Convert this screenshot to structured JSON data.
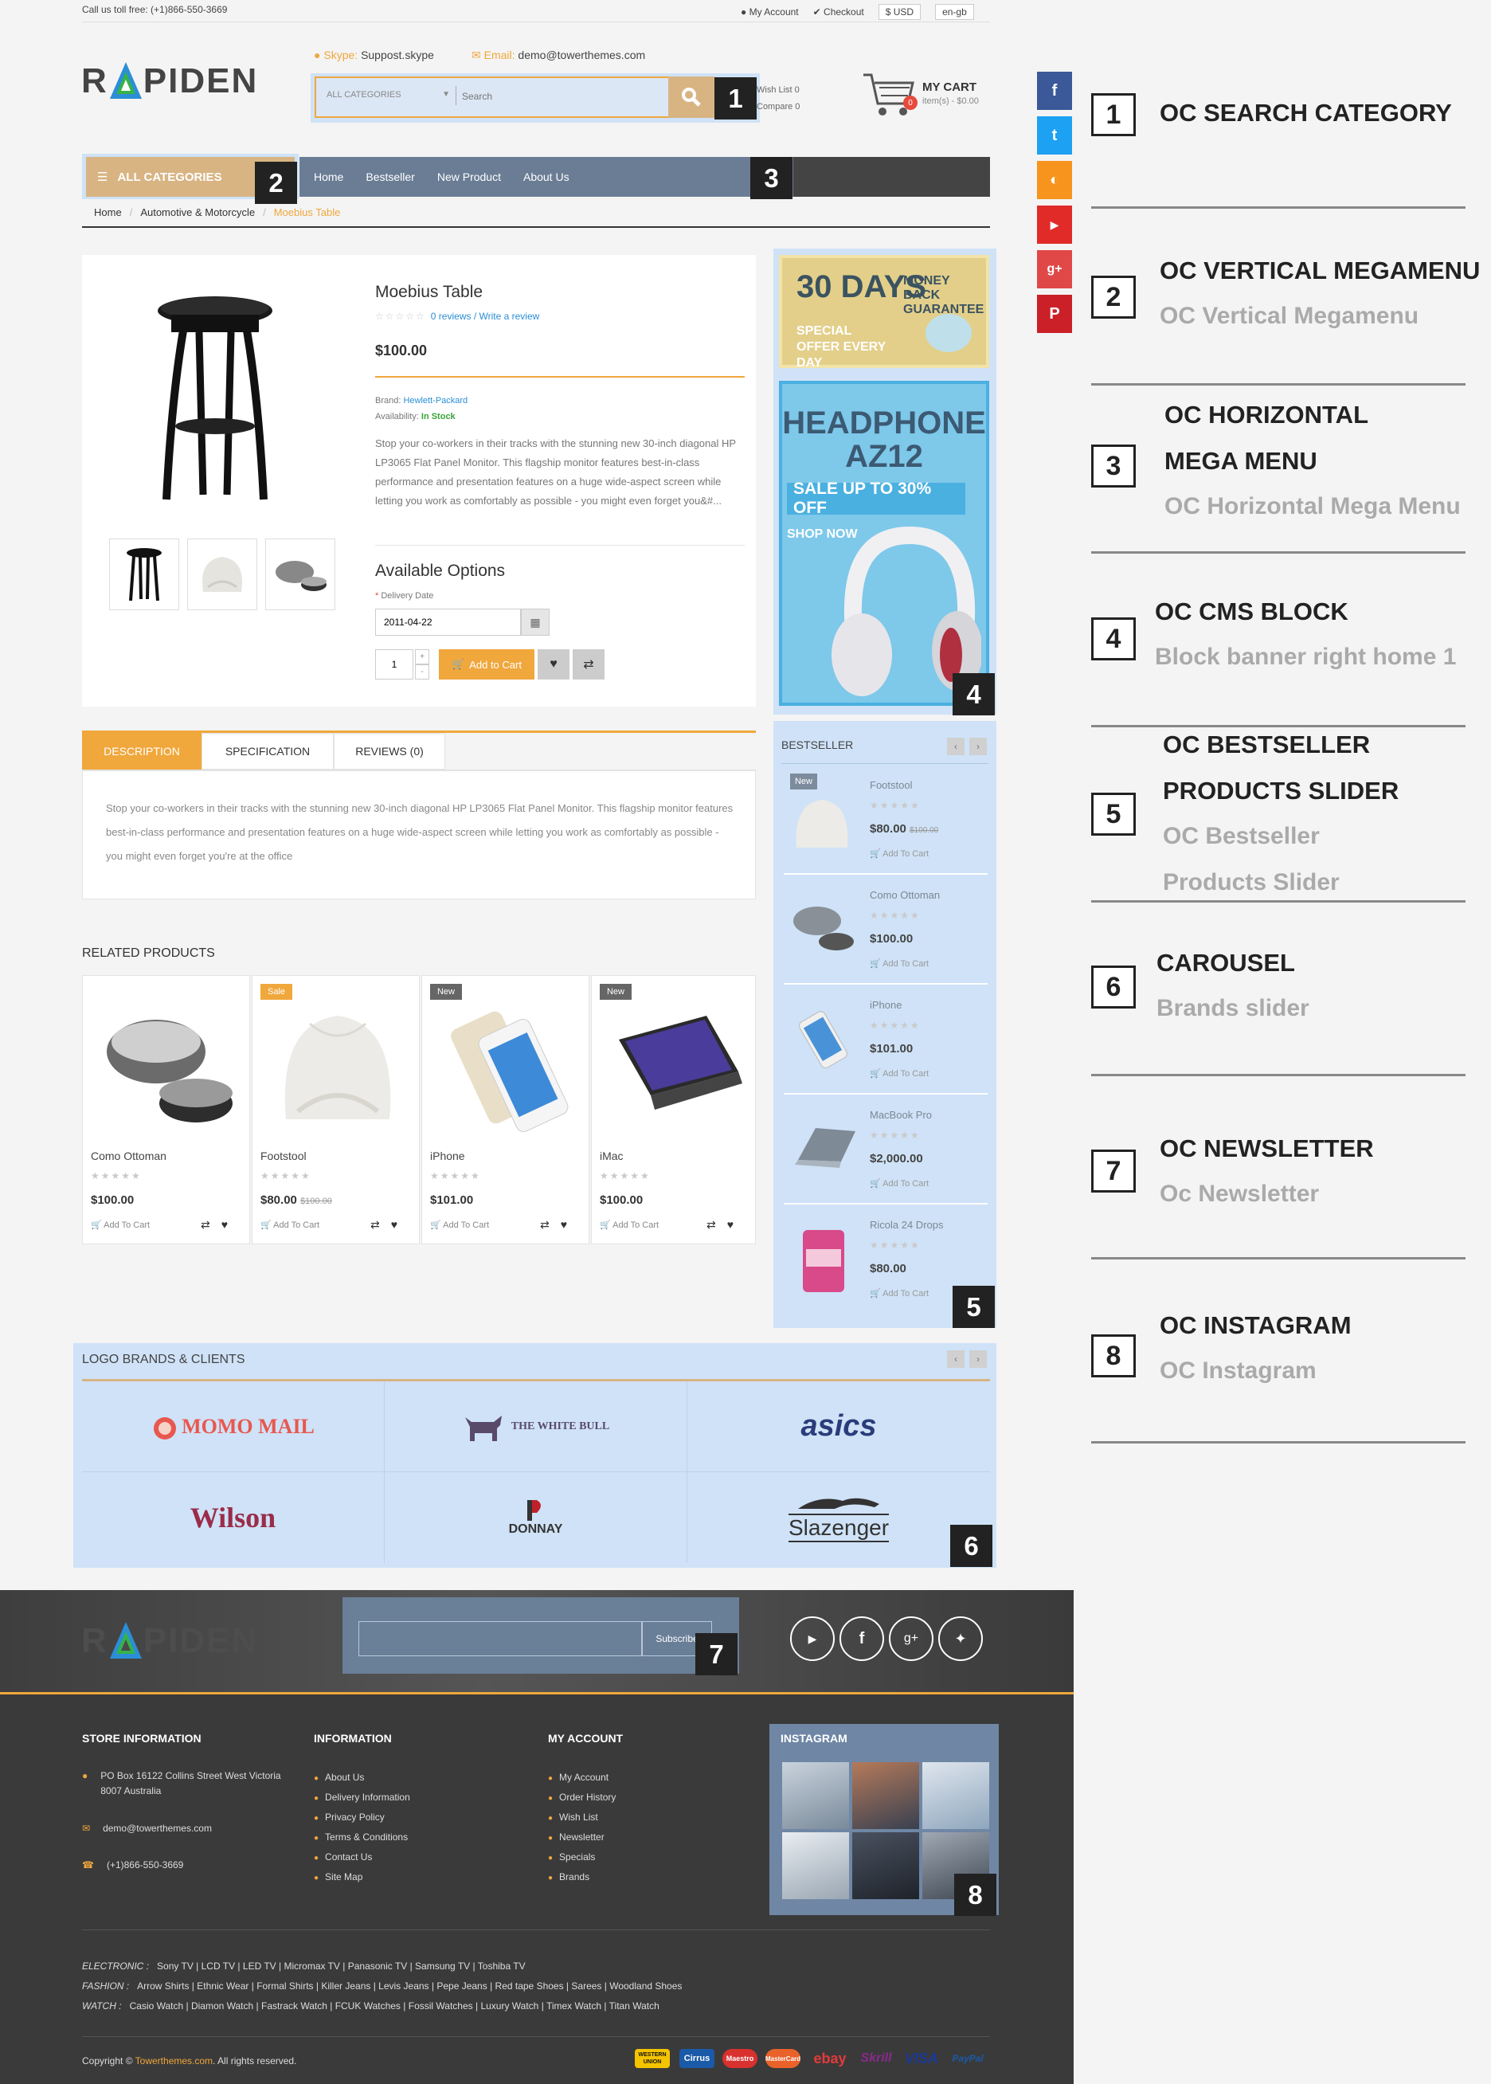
{
  "topbar": {
    "phone": "Call us toll free: (+1)866-550-3669",
    "my_account": "My Account",
    "checkout": "Checkout",
    "currency": "$ USD",
    "language": "en-gb"
  },
  "header": {
    "logo_a": "R",
    "logo_b": "PIDEN",
    "skype_label": "Skype:",
    "skype_value": "Suppost.skype",
    "email_label": "Email:",
    "email_value": "demo@towerthemes.com",
    "search_category": "ALL CATEGORIES",
    "search_placeholder": "Search",
    "wishlist": "Wish List 0",
    "compare": "Compare 0",
    "cart_title": "MY CART",
    "cart_count": "0",
    "cart_sub": "item(s) - $0.00"
  },
  "nav": {
    "all_categories": "ALL CATEGORIES",
    "items": [
      "Home",
      "Bestseller",
      "New Product",
      "About Us"
    ]
  },
  "breadcrumb": [
    "Home",
    "Automotive & Motorcycle",
    "Moebius Table"
  ],
  "product": {
    "name": "Moebius Table",
    "reviews": "0 reviews / Write a review",
    "price": "$100.00",
    "brand_label": "Brand:",
    "brand": "Hewlett-Packard",
    "availability_label": "Availability:",
    "availability": "In Stock",
    "description": "Stop your co-workers in their tracks with the stunning new 30-inch diagonal HP LP3065 Flat Panel Monitor. This flagship monitor features best-in-class performance and presentation features on a huge wide-aspect screen while letting you work as comfortably as possible - you might even forget you&#...",
    "options_title": "Available Options",
    "delivery_label": "Delivery Date",
    "delivery_value": "2011-04-22",
    "qty": "1",
    "add_to_cart": "Add to Cart"
  },
  "tabs": {
    "items": [
      "DESCRIPTION",
      "SPECIFICATION",
      "REVIEWS (0)"
    ],
    "content": "Stop your co-workers in their tracks with the stunning new 30-inch diagonal HP LP3065 Flat Panel Monitor. This flagship monitor features best-in-class performance and presentation features on a huge wide-aspect screen while letting you work as comfortably as possible - you might even forget you're at the office"
  },
  "related": {
    "title": "RELATED PRODUCTS",
    "items": [
      {
        "name": "Como Ottoman",
        "price": "$100.00",
        "old": "",
        "badge": ""
      },
      {
        "name": "Footstool",
        "price": "$80.00",
        "old": "$100.00",
        "badge": "Sale"
      },
      {
        "name": "iPhone",
        "price": "$101.00",
        "old": "",
        "badge": "New"
      },
      {
        "name": "iMac",
        "price": "$100.00",
        "old": "",
        "badge": "New"
      }
    ],
    "add_label": "Add To Cart"
  },
  "banners": {
    "b1_big": "30 DAYS",
    "b1_side": "MONEY BACK GUARANTEE",
    "b1_sub": "SPECIAL OFFER EVERY DAY",
    "b2_title": "HEADPHONE AZ12",
    "b2_sale": "SALE UP TO 30% OFF",
    "b2_shop": "SHOP NOW"
  },
  "bestseller": {
    "title": "BESTSELLER",
    "items": [
      {
        "name": "Footstool",
        "price": "$80.00",
        "old": "$100.00",
        "badge": "New"
      },
      {
        "name": "Como Ottoman",
        "price": "$100.00",
        "old": "",
        "badge": ""
      },
      {
        "name": "iPhone",
        "price": "$101.00",
        "old": "",
        "badge": ""
      },
      {
        "name": "MacBook Pro",
        "price": "$2,000.00",
        "old": "",
        "badge": ""
      },
      {
        "name": "Ricola 24 Drops",
        "price": "$80.00",
        "old": "",
        "badge": ""
      }
    ],
    "add_label": "Add To Cart"
  },
  "brands": {
    "title": "LOGO BRANDS & CLIENTS",
    "items": [
      "MOMO MAIL",
      "THE WHITE BULL",
      "asics",
      "Wilson",
      "DONNAY",
      "Slazenger"
    ]
  },
  "newsletter": {
    "subscribe": "Subscribe"
  },
  "footer": {
    "store_title": "STORE INFORMATION",
    "address": "PO Box 16122 Collins Street West Victoria 8007 Australia",
    "email": "demo@towerthemes.com",
    "phone": "(+1)866-550-3669",
    "info_title": "INFORMATION",
    "info_items": [
      "About Us",
      "Delivery Information",
      "Privacy Policy",
      "Terms & Conditions",
      "Contact Us",
      "Site Map"
    ],
    "account_title": "MY ACCOUNT",
    "account_items": [
      "My Account",
      "Order History",
      "Wish List",
      "Newsletter",
      "Specials",
      "Brands"
    ],
    "instagram_title": "INSTAGRAM",
    "tags": [
      {
        "label": "ELECTRONIC :",
        "items": [
          "Sony TV",
          "LCD TV",
          "LED TV",
          "Micromax TV",
          "Panasonic TV",
          "Samsung TV",
          "Toshiba TV"
        ]
      },
      {
        "label": "FASHION :",
        "items": [
          "Arrow Shirts",
          "Ethnic Wear",
          "Formal Shirts",
          "Killer Jeans",
          "Levis Jeans",
          "Pepe Jeans",
          "Red tape Shoes",
          "Sarees",
          "Woodland Shoes"
        ]
      },
      {
        "label": "WATCH :",
        "items": [
          "Casio Watch",
          "Diamon Watch",
          "Fastrack Watch",
          "FCUK Watches",
          "Fossil Watches",
          "Luxury Watch",
          "Timex Watch",
          "Titan Watch"
        ]
      }
    ],
    "copyright_a": "Copyright ©",
    "copyright_link": "Towerthemes.com",
    "copyright_b": ". All rights reserved.",
    "payments": [
      "WESTERN UNION",
      "Cirrus",
      "Maestro",
      "MasterCard",
      "ebay",
      "Skrill",
      "VISA",
      "PayPal"
    ]
  },
  "legend": [
    {
      "num": "1",
      "title": [
        "OC SEARCH CATEGORY"
      ],
      "sub": []
    },
    {
      "num": "2",
      "title": [
        "OC VERTICAL MEGAMENU"
      ],
      "sub": [
        "OC Vertical Megamenu"
      ]
    },
    {
      "num": "3",
      "title": [
        "OC HORIZONTAL",
        "MEGA MENU"
      ],
      "sub": [
        "OC Horizontal Mega Menu"
      ]
    },
    {
      "num": "4",
      "title": [
        "OC CMS BLOCK"
      ],
      "sub": [
        "Block banner right home 1"
      ]
    },
    {
      "num": "5",
      "title": [
        "OC BESTSELLER",
        "PRODUCTS SLIDER"
      ],
      "sub": [
        "OC Bestseller",
        "Products Slider"
      ]
    },
    {
      "num": "6",
      "title": [
        "CAROUSEL"
      ],
      "sub": [
        "Brands slider"
      ]
    },
    {
      "num": "7",
      "title": [
        "OC NEWSLETTER"
      ],
      "sub": [
        "Oc Newsletter"
      ]
    },
    {
      "num": "8",
      "title": [
        "OC INSTAGRAM"
      ],
      "sub": [
        "OC Instagram"
      ]
    }
  ],
  "colors": {
    "accent": "#f0a73c",
    "nav": "#6a7d95",
    "highlight": "#cfe2f7",
    "footer": "#3a3a3a"
  }
}
